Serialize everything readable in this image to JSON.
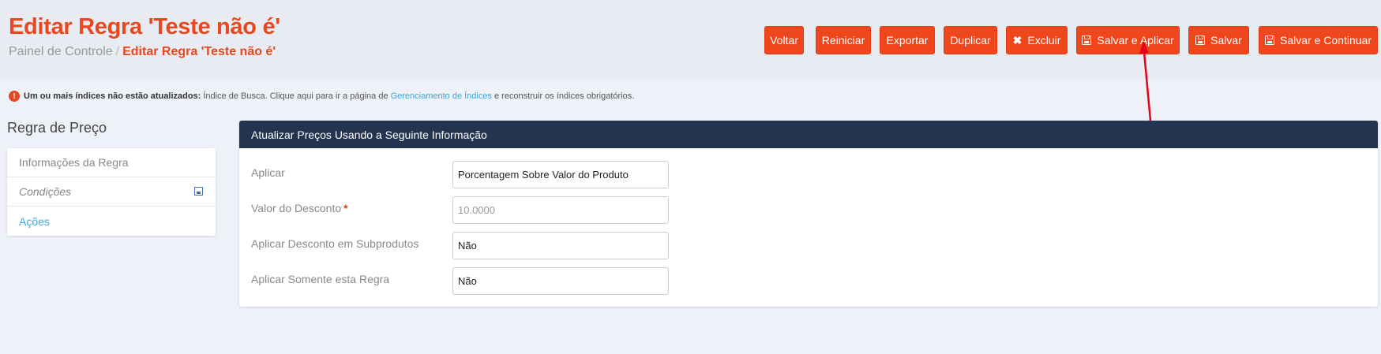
{
  "header": {
    "title": "Editar Regra 'Teste não é'",
    "breadcrumb": {
      "home": "Painel de Controle",
      "separator": "/",
      "current": "Editar Regra 'Teste não é'"
    }
  },
  "toolbar": {
    "back": "Voltar",
    "reset": "Reiniciar",
    "export": "Exportar",
    "duplicate": "Duplicar",
    "delete": "Excluir",
    "save_apply": "Salvar e Aplicar",
    "save": "Salvar",
    "save_continue": "Salvar e Continuar"
  },
  "alert": {
    "bold": "Um ou mais índices não estão atualizados:",
    "text_before": "Índice de Busca. Clique aqui para ir a página de",
    "link": "Gerenciamento de Índices",
    "text_after": "e reconstruir os índices obrigatórios."
  },
  "sidebar": {
    "title": "Regra de Preço",
    "items": [
      "Informações da Regra",
      "Condições",
      "Ações"
    ]
  },
  "panel": {
    "title": "Atualizar Preços Usando a Seguinte Informação",
    "fields": [
      {
        "label": "Aplicar",
        "value": "Porcentagem Sobre Valor do Produto"
      },
      {
        "label": "Valor do Desconto",
        "required_mark": "*",
        "value": "10.0000"
      },
      {
        "label": "Aplicar Desconto em Subprodutos",
        "value": "Não"
      },
      {
        "label": "Aplicar Somente esta Regra",
        "value": "Não"
      }
    ]
  },
  "colors": {
    "accent": "#f0461b",
    "panel_header": "#22344f",
    "link": "#3ea7d8",
    "annotation": "#e8001c"
  },
  "icons": {
    "delete": "close-icon",
    "save": "floppy-icon",
    "alert": "exclamation-icon"
  }
}
